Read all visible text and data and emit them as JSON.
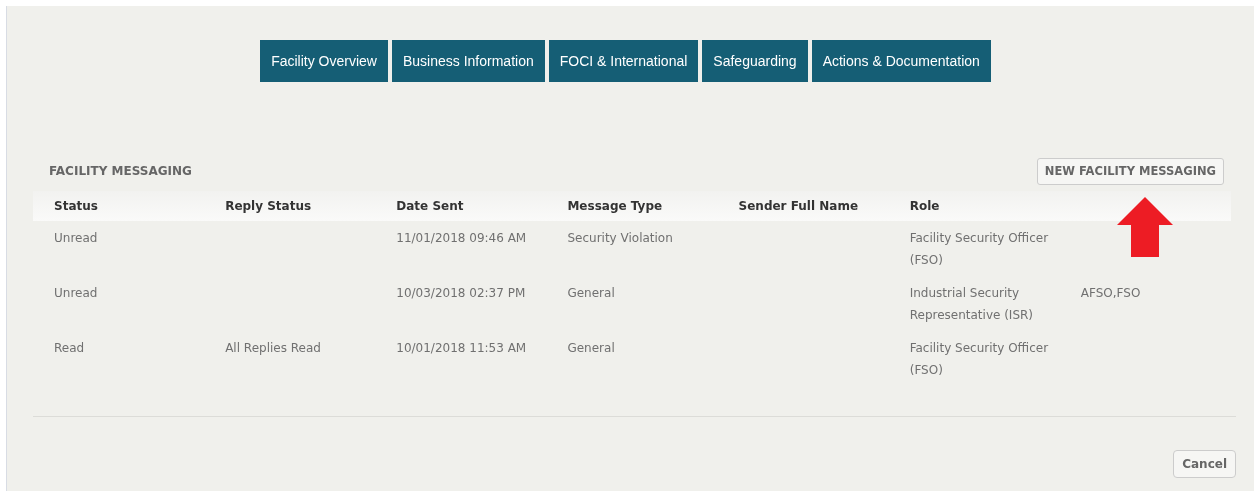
{
  "tabs": [
    {
      "label": "Facility Overview"
    },
    {
      "label": "Business Information"
    },
    {
      "label": "FOCI & International"
    },
    {
      "label": "Safeguarding"
    },
    {
      "label": "Actions & Documentation"
    }
  ],
  "section": {
    "title": "FACILITY MESSAGING",
    "new_button": "NEW FACILITY MESSAGING"
  },
  "table": {
    "columns": [
      "Status",
      "Reply Status",
      "Date Sent",
      "Message Type",
      "Sender Full Name",
      "Role"
    ],
    "rows": [
      {
        "cells": [
          "Unread",
          "",
          "11/01/2018 09:46 AM",
          "Security Violation",
          "",
          "Facility Security Officer (FSO)",
          ""
        ]
      },
      {
        "cells": [
          "Unread",
          "",
          "10/03/2018 02:37 PM",
          "General",
          "",
          "Industrial Security Representative (ISR)",
          "AFSO,FSO"
        ]
      },
      {
        "cells": [
          "Read",
          "All Replies Read",
          "10/01/2018 11:53 AM",
          "General",
          "",
          "Facility Security Officer (FSO)",
          ""
        ]
      }
    ]
  },
  "footer": {
    "cancel_button": "Cancel"
  }
}
